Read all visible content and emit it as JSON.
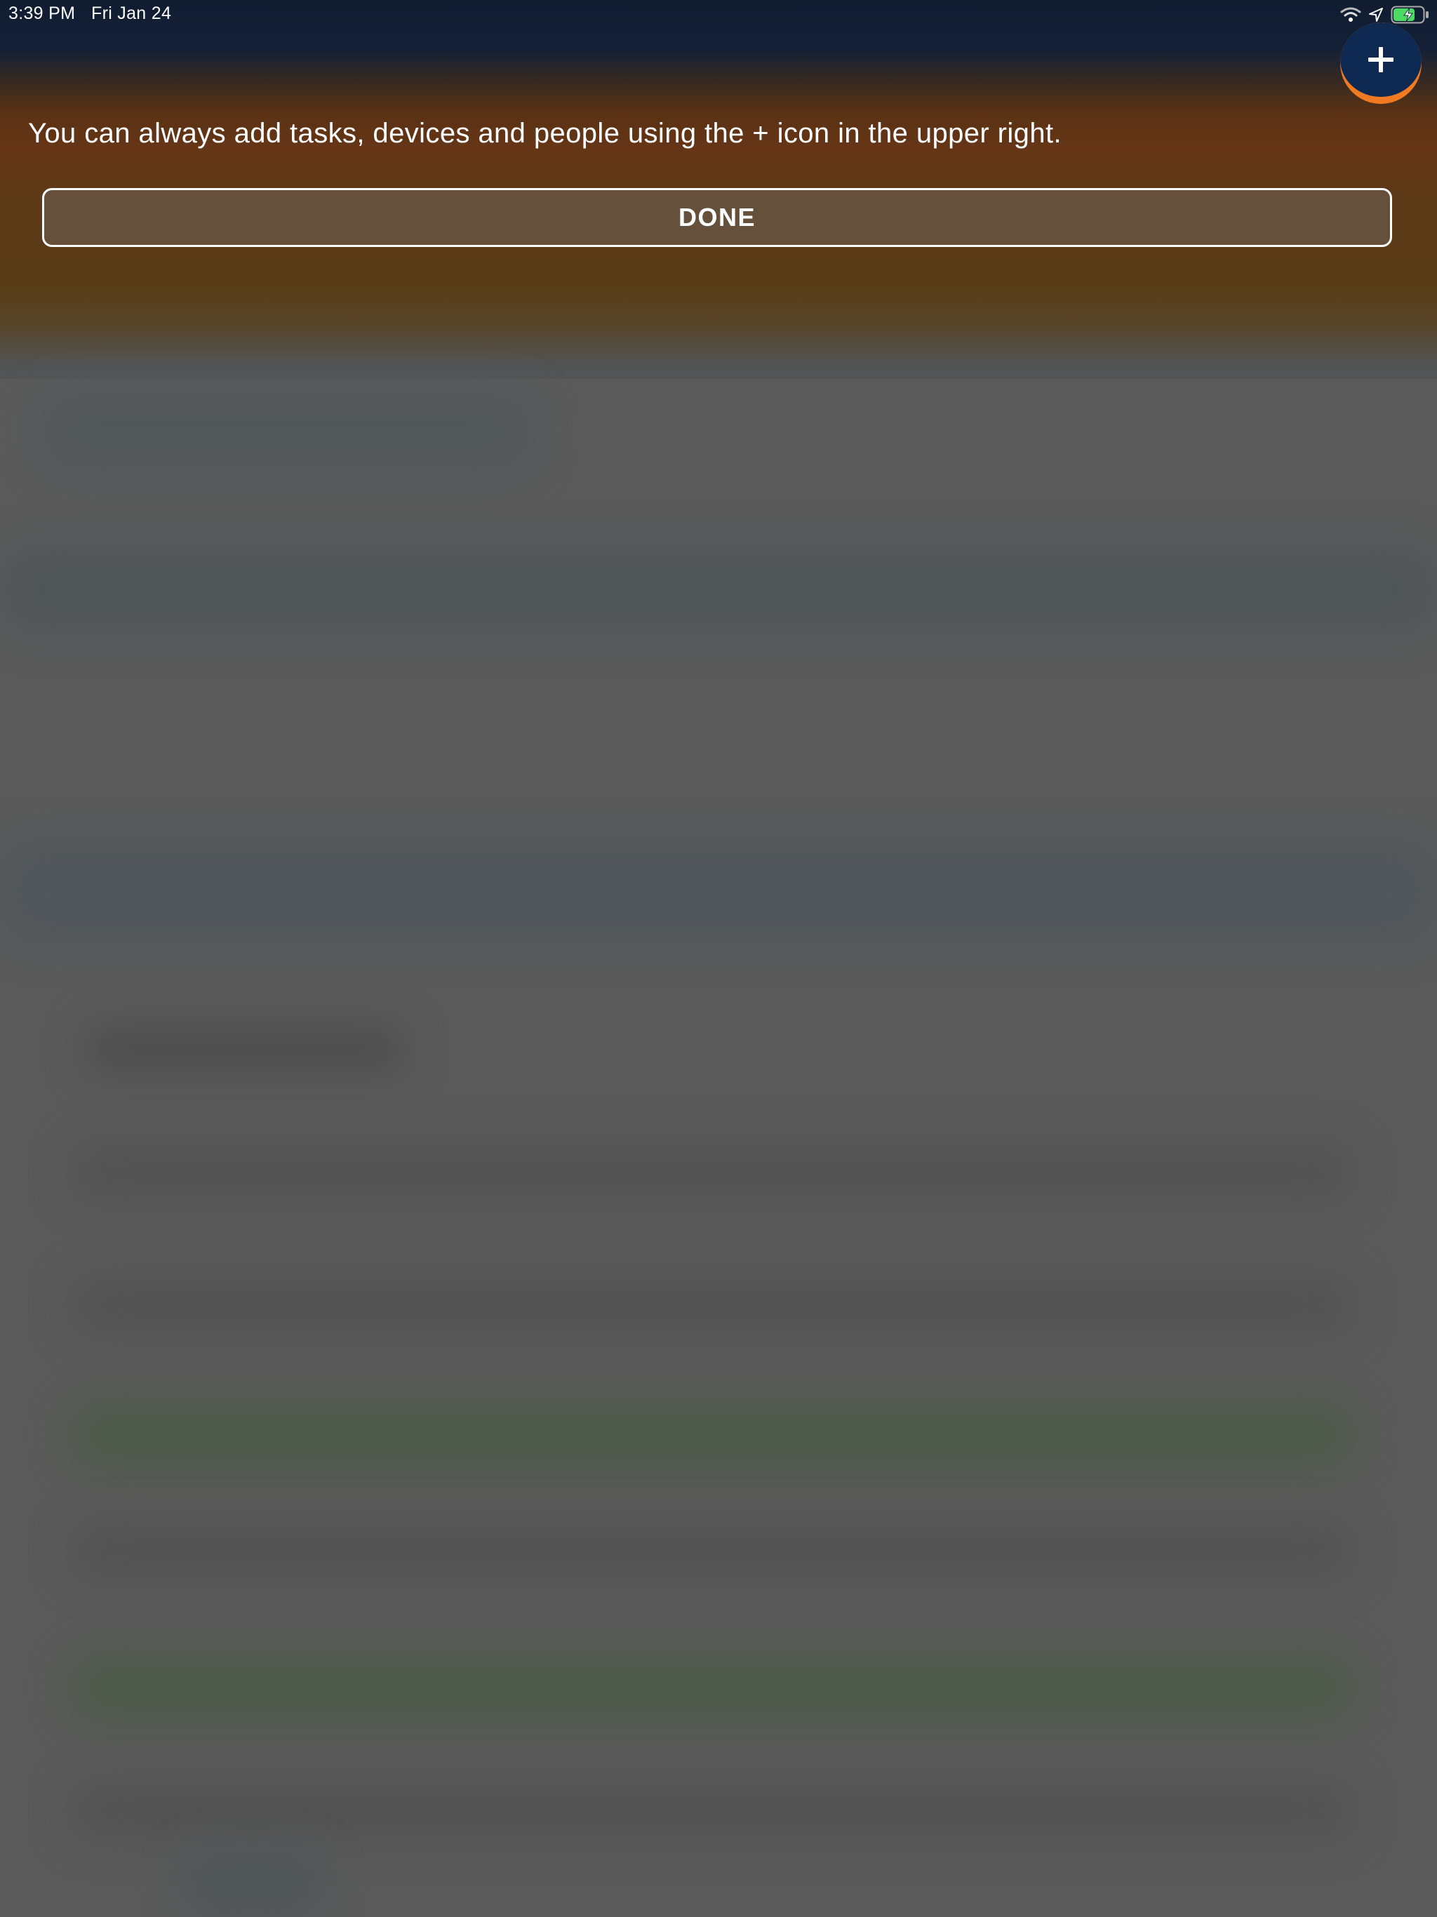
{
  "status_bar": {
    "time": "3:39 PM",
    "date": "Fri Jan 24"
  },
  "fab": {
    "icon": "plus-icon"
  },
  "onboarding": {
    "hint": "You can always add tasks, devices and people using the + icon in the upper right.",
    "done_label": "DONE"
  },
  "colors": {
    "fab_fill": "#0e2a52",
    "fab_accent": "#f07a22",
    "battery_green": "#4cd964"
  }
}
